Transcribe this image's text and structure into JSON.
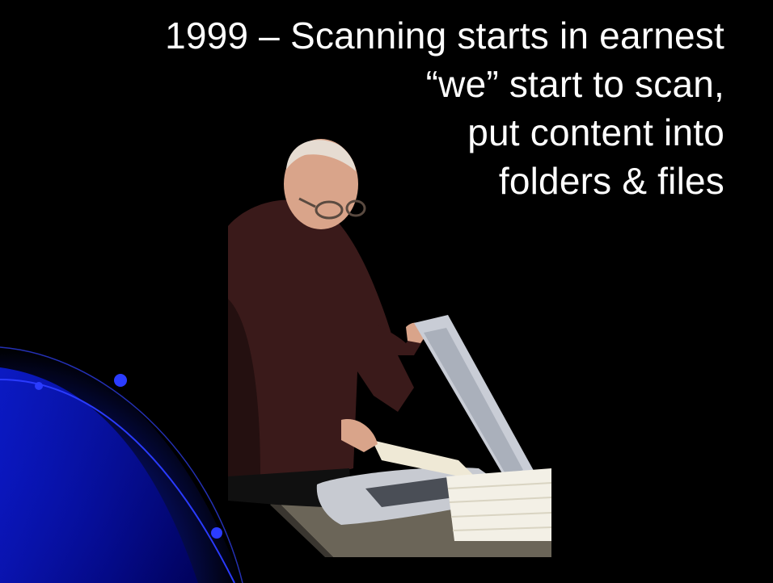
{
  "slide": {
    "lines": [
      "1999 – Scanning starts in earnest",
      "“we” start to scan,",
      "put content into",
      "folders & files"
    ]
  },
  "colors": {
    "background": "#000000",
    "accent_blue": "#0b1fd6",
    "text": "#ffffff"
  }
}
